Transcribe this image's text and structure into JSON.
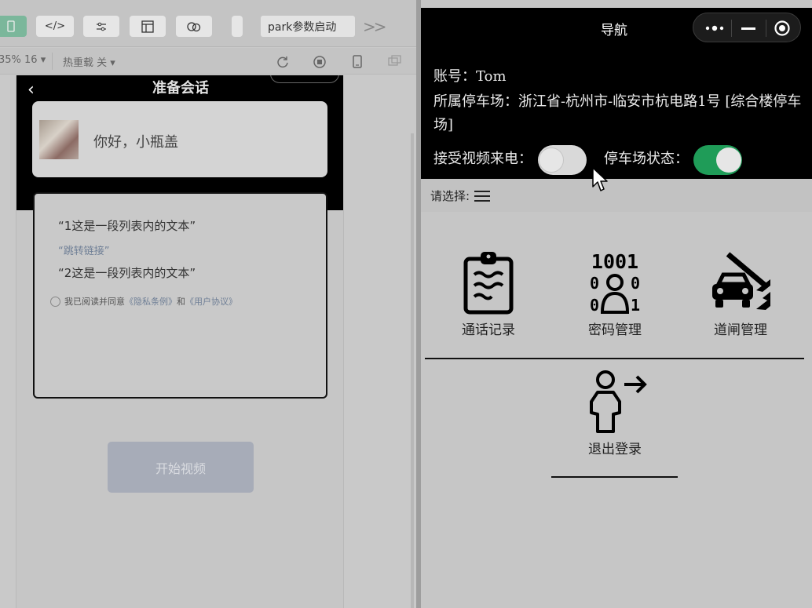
{
  "ide": {
    "toolbar": {
      "project_name": "park参数启动",
      "code_icon_label": "</>"
    },
    "toolbar2": {
      "zoom_label": "35% 16 ▾",
      "hot_reload_label": "热重载 关 ▾"
    }
  },
  "simulator": {
    "back_icon": "‹",
    "title": "准备会话",
    "greeting": "你好，小瓶盖",
    "list_item_1": "“1这是一段列表内的文本”",
    "link_text": "“跳转链接”",
    "list_item_2": "“2这是一段列表内的文本”",
    "agree_prefix": "我已阅读并同意",
    "privacy_link": "《隐私条例》",
    "agree_and": "和",
    "user_agreement_link": "《用户协议》",
    "start_button": "开始视频"
  },
  "app": {
    "nav_title": "导航",
    "capsule": {
      "more_icon": "•●•",
      "minimize_icon": "—"
    },
    "account": "账号：Tom",
    "parking_lot": "所属停车场：浙江省-杭州市-临安市杭电路1号 [综合楼停车场]",
    "video_call_label": "接受视频来电：",
    "video_call_on": false,
    "lot_status_label": "停车场状态：",
    "lot_status_on": true,
    "select_label": "请选择:",
    "grid": [
      {
        "label": "通话记录",
        "icon": "clipboard-icon"
      },
      {
        "label": "密码管理",
        "icon": "binary-person-icon"
      },
      {
        "label": "道闸管理",
        "icon": "barrier-gate-car-icon"
      },
      {
        "label": "退出登录",
        "icon": "logout-person-icon"
      }
    ]
  },
  "colors": {
    "toggle_on": "#1f9c58",
    "nav_background": "#000000",
    "page_background": "#c6c6c6",
    "link": "#6f7f96"
  }
}
